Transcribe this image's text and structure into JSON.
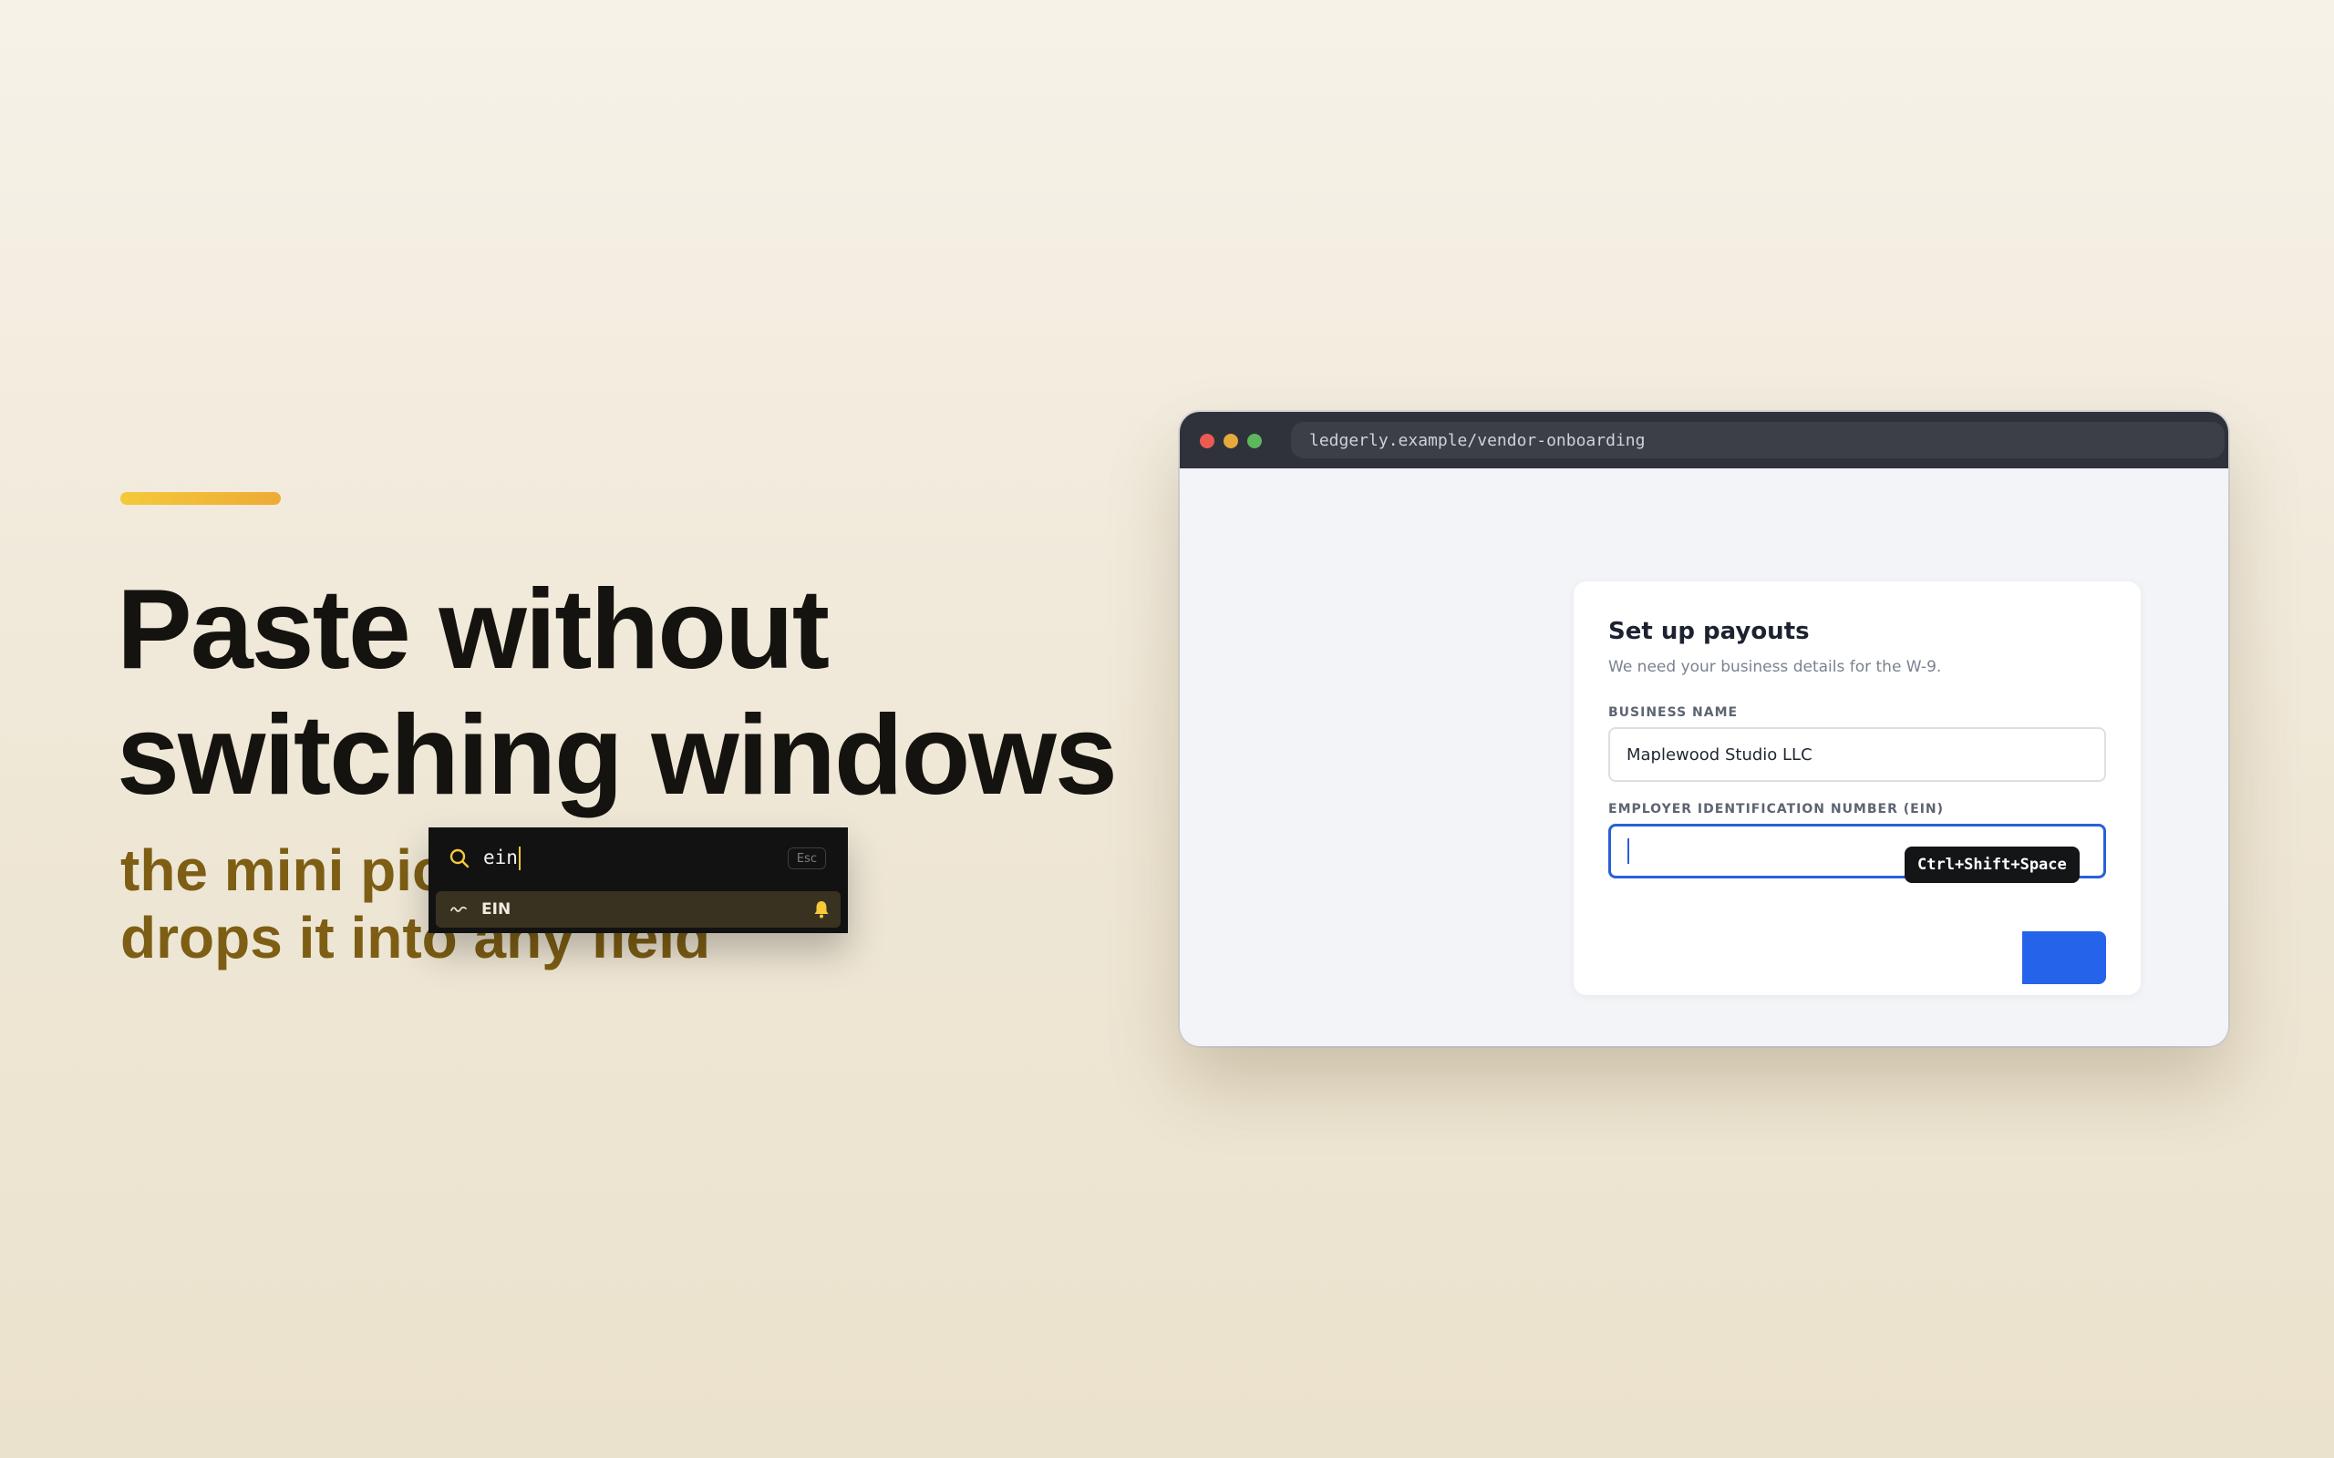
{
  "hero": {
    "headline_line1": "Paste without",
    "headline_line2": "switching windows",
    "subline_line1": "the mini picker",
    "subline_line2": "drops it into any field"
  },
  "browser": {
    "url": "ledgerly.example/vendor-onboarding"
  },
  "form": {
    "title": "Set up payouts",
    "subtitle": "We need your business details for the W-9.",
    "business_name_label": "BUSINESS NAME",
    "business_name_value": "Maplewood Studio LLC",
    "ein_label": "EMPLOYER IDENTIFICATION NUMBER (EIN)",
    "ein_value": ""
  },
  "shortcut": {
    "label": "Ctrl+Shift+Space"
  },
  "picker": {
    "query": "ein",
    "esc_label": "Esc",
    "items": [
      {
        "label": "EIN",
        "icon": "wave-icon",
        "badge_icon": "bell-icon"
      }
    ]
  },
  "colors": {
    "accent_yellow": "#f5c93a",
    "headline": "#15130f",
    "subline": "#7d5e14",
    "primary_blue": "#2563eb",
    "picker_bg": "#121212",
    "picker_selected": "#3a3220"
  }
}
